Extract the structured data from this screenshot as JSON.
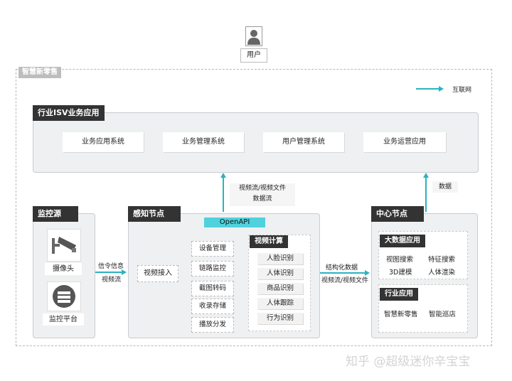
{
  "user": {
    "label": "用户"
  },
  "outer": {
    "label": "智慧新零售"
  },
  "legend": {
    "label": "互联网"
  },
  "isv": {
    "title": "行业ISV业务应用",
    "items": [
      "业务应用系统",
      "业务管理系统",
      "用户管理系统",
      "业务运营应用"
    ]
  },
  "flow_up_left": {
    "line1": "视频流/视频文件",
    "line2": "数据流"
  },
  "flow_up_right": {
    "line1": "数据"
  },
  "monitor": {
    "title": "监控源",
    "camera": "摄像头",
    "platform": "监控平台"
  },
  "flow_left": {
    "line1": "信令信息",
    "line2": "视频流"
  },
  "sensing": {
    "title": "感知节点",
    "openapi": "OpenAPI",
    "access": "视频接入",
    "functions": [
      "设备管理",
      "链路监控",
      "截图转码",
      "收录存储",
      "播放分发"
    ],
    "compute": {
      "title": "视频计算",
      "items": [
        "人脸识别",
        "人体识别",
        "商品识别",
        "人体跟踪",
        "行为识别"
      ]
    }
  },
  "flow_mid": {
    "line1": "结构化数据",
    "line2": "视频流/视频文件"
  },
  "center": {
    "title": "中心节点",
    "bigdata": {
      "title": "大数据应用",
      "items": [
        "视图搜索",
        "特征搜索",
        "3D建模",
        "人体渲染"
      ]
    },
    "industry": {
      "title": "行业应用",
      "items": [
        "智慧新零售",
        "智能巡店"
      ]
    }
  },
  "watermark": "知乎 @超级迷你辛宝宝",
  "colors": {
    "arrow": "#2bb3c0",
    "openapi": "#4fd2dc",
    "dark_label": "#333333"
  }
}
